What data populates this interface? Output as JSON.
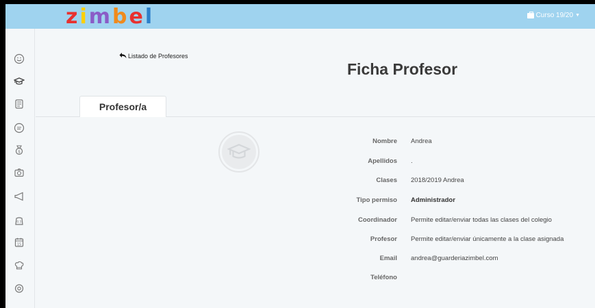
{
  "header": {
    "logo_letters": [
      {
        "char": "z",
        "color": "#e8312f"
      },
      {
        "char": "i",
        "color": "#ffd000"
      },
      {
        "char": "m",
        "color": "#8a5cc7"
      },
      {
        "char": "b",
        "color": "#f08a1c"
      },
      {
        "char": "e",
        "color": "#e8312f"
      },
      {
        "char": "l",
        "color": "#2c7fc9"
      }
    ],
    "course_label": "Curso 19/20",
    "course_icon": "briefcase-icon",
    "caret_icon": "caret-down-icon"
  },
  "sidebar": {
    "items": [
      {
        "icon": "smiley-face-icon"
      },
      {
        "icon": "graduation-cap-icon"
      },
      {
        "icon": "notebook-icon"
      },
      {
        "icon": "chat-bubble-icon"
      },
      {
        "icon": "money-bag-icon"
      },
      {
        "icon": "camera-icon"
      },
      {
        "icon": "megaphone-icon"
      },
      {
        "icon": "scale-icon"
      },
      {
        "icon": "calendar-icon"
      },
      {
        "icon": "chef-hat-icon"
      },
      {
        "icon": "map-pin-icon"
      }
    ]
  },
  "main": {
    "back_label": "Listado de Profesores",
    "title": "Ficha Profesor",
    "tab_label": "Profesor/a",
    "details": [
      {
        "label": "Nombre",
        "value": "Andrea",
        "bold": false
      },
      {
        "label": "Apellidos",
        "value": ".",
        "bold": false
      },
      {
        "label": "Clases",
        "value": "2018/2019 Andrea",
        "bold": false
      },
      {
        "label": "Tipo permiso",
        "value": "Administrador",
        "bold": true
      },
      {
        "label": "Coordinador",
        "value": "Permite editar/enviar todas las clases del colegio",
        "bold": false
      },
      {
        "label": "Profesor",
        "value": "Permite editar/enviar únicamente a la clase asignada",
        "bold": false
      },
      {
        "label": "Email",
        "value": "andrea@guarderiazimbel.com",
        "bold": false
      },
      {
        "label": "Teléfono",
        "value": "",
        "bold": false
      }
    ]
  },
  "colors": {
    "topbar": "#9fd3ef",
    "background": "#f4f7f9",
    "sidebar_icon": "#777777"
  }
}
